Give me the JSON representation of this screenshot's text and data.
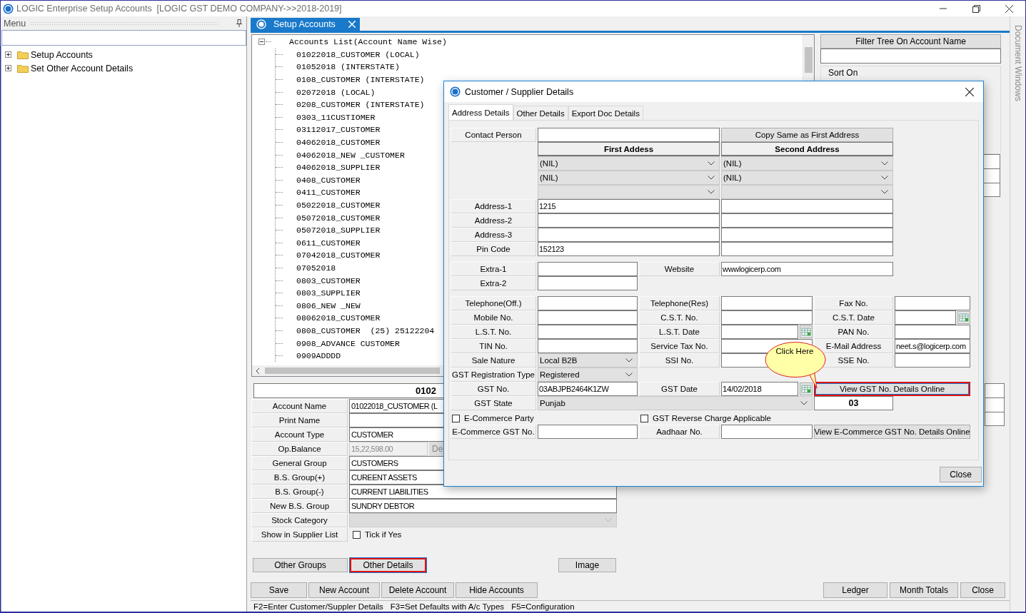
{
  "window": {
    "title": "LOGIC Enterprise Setup Accounts  [LOGIC GST DEMO COMPANY->>2018-2019]"
  },
  "menu": {
    "title": "Menu",
    "items": [
      {
        "label": "Setup Accounts",
        "expanded": false
      },
      {
        "label": "Set Other Account Details",
        "expanded": false
      }
    ]
  },
  "tabs": [
    {
      "label": "Setup Accounts",
      "selected": true
    }
  ],
  "accounts_tree": {
    "title": "Accounts List(Account Name Wise)",
    "expanded": true,
    "items": [
      "01022018_CUSTOMER (LOCAL)",
      "01052018 (INTERSTATE)",
      "0108_CUSTOMER (INTERSTATE)",
      "02072018 (LOCAL)",
      "0208_CUSTOMER (INTERSTATE)",
      "0303_11CUSTIOMER",
      "03112017_CUSTOMER",
      "04062018_CUSTOMER",
      "04062018_NEW _CUSTOMER",
      "04062018_SUPPLIER",
      "0408_CUSTOMER",
      "0411_CUSTOMER",
      "05022018_CUSTOMER",
      "05072018_CUSTOMER",
      "05072018_SUPPLIER",
      "0611_CUSTOMER",
      "07042018_CUSTOMER",
      "07052018",
      "0803_CUSTOMER",
      "0803_SUPPLIER",
      "0806_NEW _NEW",
      "08062018_CUSTOMER",
      "0808_CUSTOMER  (25) 25122204",
      "0908_ADVANCE CUSTOMER",
      "0909ADDDD"
    ]
  },
  "filter_panel": {
    "button": "Filter Tree On Account Name",
    "sort_label": "Sort On"
  },
  "account_heading": "0102",
  "account_fields": [
    {
      "kind": "text",
      "label": "Account Name",
      "value": "01022018_CUSTOMER (L"
    },
    {
      "kind": "text",
      "label": "Print Name"
    },
    {
      "kind": "text",
      "label": "Account Type",
      "value": "CUSTOMER"
    },
    {
      "kind": "balance",
      "label": "Op.Balance",
      "value": "15,22,598.00",
      "side": "De"
    },
    {
      "kind": "text",
      "label": "General Group",
      "value": "CUSTOMERS"
    },
    {
      "kind": "text",
      "label": "B.S. Group(+)",
      "value": "CUREENT ASSETS"
    },
    {
      "kind": "text",
      "label": "B.S. Group(-)",
      "value": "CURRENT LIABILITIES"
    },
    {
      "kind": "text",
      "label": "New B.S. Group",
      "value": "SUNDRY DEBTOR"
    },
    {
      "kind": "combo",
      "label": "Stock Category",
      "disabled": true
    },
    {
      "kind": "check",
      "label": "Show in Supplier List",
      "text": "Tick if Yes",
      "checked": false
    }
  ],
  "form_buttons": [
    {
      "label": "Other Groups",
      "highlighted": false
    },
    {
      "label": "Other Details",
      "highlighted": true
    },
    {
      "label": "Image",
      "highlighted": false
    }
  ],
  "action_buttons": [
    {
      "label": "Save"
    },
    {
      "label": "New Account"
    },
    {
      "label": "Delete Account"
    },
    {
      "label": "Hide Accounts"
    }
  ],
  "report_buttons": [
    {
      "label": "Ledger"
    },
    {
      "label": "Month Totals"
    },
    {
      "label": "Close"
    }
  ],
  "status_bar": [
    "F2=Enter Customer/Suppler Details",
    "F3=Set Defaults with A/c Types",
    "F5=Configuration"
  ],
  "side_panel": {
    "title": "Document Windows"
  },
  "dialog": {
    "title": "Customer / Supplier Details",
    "tabs": [
      {
        "label": "Address Details",
        "selected": true
      },
      {
        "label": "Other Details",
        "selected": false
      },
      {
        "label": "Export Doc Details",
        "selected": false
      }
    ],
    "sections": [
      {
        "rows": [
          {
            "cells": [
              {
                "kind": "label",
                "text": "Contact Person"
              },
              {
                "kind": "wide_input"
              },
              {
                "kind": "wide_button",
                "label": "Copy Same as First Address",
                "highlighted": false
              }
            ]
          },
          {
            "cells": [
              {
                "kind": "blank"
              },
              {
                "kind": "header",
                "text": "First Addess"
              },
              {
                "kind": "header",
                "text": "Second Address"
              }
            ]
          },
          {
            "cells": [
              {
                "kind": "blank"
              },
              {
                "kind": "wide_combo",
                "value": "(NIL)"
              },
              {
                "kind": "wide_combo",
                "value": "(NIL)"
              }
            ]
          },
          {
            "cells": [
              {
                "kind": "blank"
              },
              {
                "kind": "wide_combo",
                "value": "(NIL)"
              },
              {
                "kind": "wide_combo",
                "value": "(NIL)"
              }
            ]
          },
          {
            "cells": [
              {
                "kind": "blank"
              },
              {
                "kind": "wide_combo"
              },
              {
                "kind": "wide_combo"
              }
            ]
          },
          {
            "cells": [
              {
                "kind": "label",
                "text": "Address-1"
              },
              {
                "kind": "wide_input",
                "value": "1215"
              },
              {
                "kind": "wide_input"
              }
            ]
          },
          {
            "cells": [
              {
                "kind": "label",
                "text": "Address-2"
              },
              {
                "kind": "wide_input"
              },
              {
                "kind": "wide_input"
              }
            ]
          },
          {
            "cells": [
              {
                "kind": "label",
                "text": "Address-3"
              },
              {
                "kind": "wide_input"
              },
              {
                "kind": "wide_input"
              }
            ]
          },
          {
            "cells": [
              {
                "kind": "label",
                "text": "Pin Code"
              },
              {
                "kind": "wide_input",
                "value": "152123"
              },
              {
                "kind": "wide_input"
              }
            ]
          }
        ]
      },
      {
        "rows": [
          {
            "cells": [
              {
                "kind": "label",
                "text": "Extra-1"
              },
              {
                "kind": "input"
              },
              {
                "kind": "label",
                "text": "Website"
              },
              {
                "kind": "wide_input",
                "value": "wwwlogicerp.com"
              }
            ]
          },
          {
            "cells": [
              {
                "kind": "label",
                "text": "Extra-2"
              },
              {
                "kind": "input"
              }
            ]
          }
        ]
      },
      {
        "rows": [
          {
            "cells": [
              {
                "kind": "label",
                "text": "Telephone(Off.)"
              },
              {
                "kind": "input"
              },
              {
                "kind": "label",
                "text": "Telephone(Res)"
              },
              {
                "kind": "input"
              },
              {
                "kind": "label",
                "text": "Fax No."
              },
              {
                "kind": "input"
              }
            ]
          },
          {
            "cells": [
              {
                "kind": "label",
                "text": "Mobile No."
              },
              {
                "kind": "input"
              },
              {
                "kind": "label",
                "text": "C.S.T. No."
              },
              {
                "kind": "input"
              },
              {
                "kind": "label",
                "text": "C.S.T. Date"
              },
              {
                "kind": "date"
              }
            ]
          },
          {
            "cells": [
              {
                "kind": "label",
                "text": "L.S.T. No."
              },
              {
                "kind": "input"
              },
              {
                "kind": "label",
                "text": "L.S.T. Date"
              },
              {
                "kind": "date"
              },
              {
                "kind": "label",
                "text": "PAN No."
              },
              {
                "kind": "input"
              }
            ]
          },
          {
            "cells": [
              {
                "kind": "label",
                "text": "TIN No."
              },
              {
                "kind": "input"
              },
              {
                "kind": "label",
                "text": "Service Tax No."
              },
              {
                "kind": "input"
              },
              {
                "kind": "label",
                "text": "E-Mail Address"
              },
              {
                "kind": "input",
                "value": "neet.s@logicerp.com"
              }
            ]
          },
          {
            "cells": [
              {
                "kind": "label",
                "text": "Sale Nature"
              },
              {
                "kind": "combo",
                "value": "Local B2B"
              },
              {
                "kind": "label",
                "text": "SSI No."
              },
              {
                "kind": "input"
              },
              {
                "kind": "label",
                "text": "SSE No."
              },
              {
                "kind": "input"
              }
            ]
          },
          {
            "cells": [
              {
                "kind": "label",
                "text": "GST Registration Type"
              },
              {
                "kind": "combo",
                "value": "Registered"
              }
            ]
          },
          {
            "cells": [
              {
                "kind": "label",
                "text": "GST No."
              },
              {
                "kind": "input",
                "value": "03ABJPB2464K1ZW"
              },
              {
                "kind": "label",
                "text": "GST Date"
              },
              {
                "kind": "date",
                "value": "14/02/2018"
              },
              {
                "kind": "wide_button",
                "label": "View GST No. Details Online",
                "highlighted": true
              }
            ]
          },
          {
            "cells": [
              {
                "kind": "label",
                "text": "GST State"
              },
              {
                "kind": "long_combo",
                "value": "Punjab"
              },
              {
                "kind": "span"
              },
              {
                "kind": "span"
              },
              {
                "kind": "code",
                "value": "03"
              }
            ]
          },
          {
            "cells": [
              {
                "kind": "check",
                "text": "E-Commerce Party",
                "checked": false
              },
              {
                "kind": "span"
              },
              {
                "kind": "check",
                "text": "GST Reverse Charge Applicable",
                "checked": false
              }
            ]
          },
          {
            "cells": [
              {
                "kind": "label",
                "text": "E-Commerce GST No."
              },
              {
                "kind": "input"
              },
              {
                "kind": "label",
                "text": "Aadhaar No."
              },
              {
                "kind": "input"
              },
              {
                "kind": "wide_button",
                "label": "View E-Commerce GST No. Details Online",
                "highlighted": false
              }
            ]
          }
        ]
      }
    ],
    "callout": "Click Here",
    "close_button": "Close"
  }
}
